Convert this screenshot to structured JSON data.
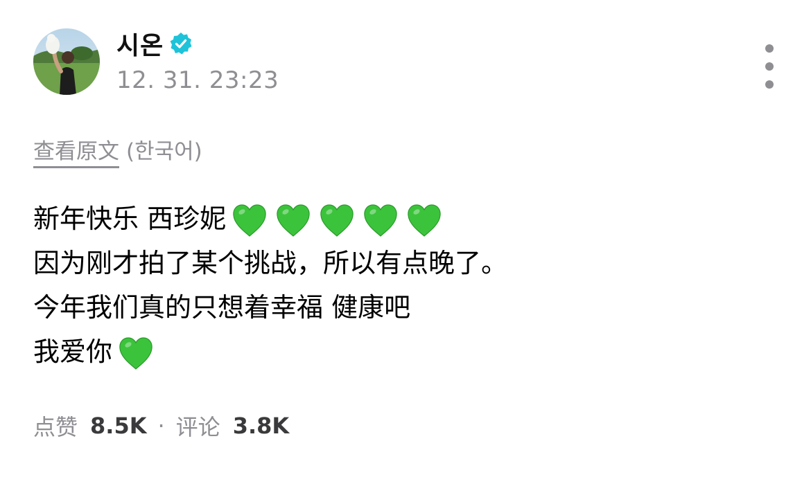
{
  "post": {
    "author": {
      "name": "시온",
      "verified": true,
      "avatar_icon": "profile-photo"
    },
    "timestamp": "12. 31. 23:23",
    "translate": {
      "link_label": "查看原文",
      "language": "(한국어)"
    },
    "lines": [
      {
        "text": "新年快乐 西珍妮",
        "hearts": 5
      },
      {
        "text": "因为刚才拍了某个挑战，所以有点晚了。",
        "hearts": 0
      },
      {
        "text": "今年我们真的只想着幸福 健康吧",
        "hearts": 0
      },
      {
        "text": "我爱你",
        "hearts": 1
      }
    ],
    "heart_icon": "green-heart",
    "stats": {
      "likes_label": "点赞",
      "likes_value": "8.5K",
      "separator": "·",
      "comments_label": "评论",
      "comments_value": "3.8K"
    }
  },
  "colors": {
    "verified_badge": "#1ec3d9",
    "heart": "#3cc33c",
    "secondary_text": "#8e8e93"
  }
}
